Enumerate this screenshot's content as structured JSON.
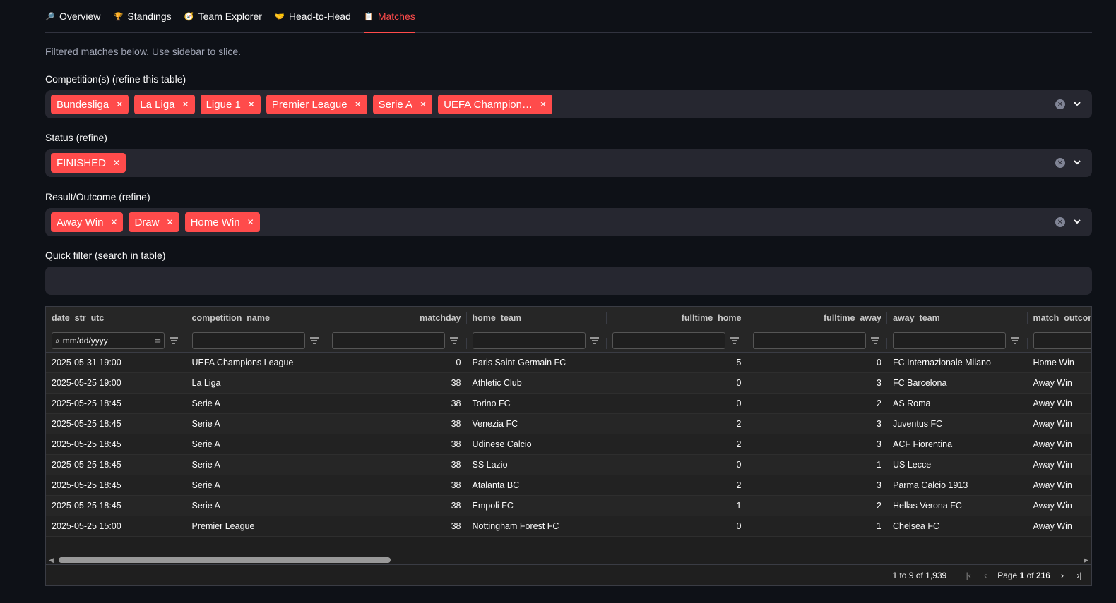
{
  "tabs": [
    {
      "icon": "magnifier-icon",
      "glyph": "🔎",
      "label": "Overview"
    },
    {
      "icon": "trophy-icon",
      "glyph": "🏆",
      "label": "Standings"
    },
    {
      "icon": "compass-icon",
      "glyph": "🧭",
      "label": "Team Explorer"
    },
    {
      "icon": "handshake-icon",
      "glyph": "🤝",
      "label": "Head-to-Head"
    },
    {
      "icon": "clipboard-icon",
      "glyph": "📋",
      "label": "Matches"
    }
  ],
  "active_tab": "Matches",
  "caption": "Filtered matches below. Use sidebar to slice.",
  "filters": {
    "competition": {
      "label": "Competition(s) (refine this table)",
      "chips": [
        "Bundesliga",
        "La Liga",
        "Ligue 1",
        "Premier League",
        "Serie A",
        "UEFA Champion…"
      ]
    },
    "status": {
      "label": "Status (refine)",
      "chips": [
        "FINISHED"
      ]
    },
    "outcome": {
      "label": "Result/Outcome (refine)",
      "chips": [
        "Away Win",
        "Draw",
        "Home Win"
      ]
    },
    "quick": {
      "label": "Quick filter (search in table)",
      "value": ""
    }
  },
  "colors": {
    "accent": "#ff4b4b",
    "background": "#0e1117",
    "input_bg": "#262730"
  },
  "grid": {
    "columns": [
      "date_str_utc",
      "competition_name",
      "matchday",
      "home_team",
      "fulltime_home",
      "fulltime_away",
      "away_team",
      "match_outcom"
    ],
    "date_placeholder": "mm/dd/yyyy",
    "rows": [
      [
        "2025-05-31 19:00",
        "UEFA Champions League",
        "0",
        "Paris Saint-Germain FC",
        "5",
        "0",
        "FC Internazionale Milano",
        "Home Win"
      ],
      [
        "2025-05-25 19:00",
        "La Liga",
        "38",
        "Athletic Club",
        "0",
        "3",
        "FC Barcelona",
        "Away Win"
      ],
      [
        "2025-05-25 18:45",
        "Serie A",
        "38",
        "Torino FC",
        "0",
        "2",
        "AS Roma",
        "Away Win"
      ],
      [
        "2025-05-25 18:45",
        "Serie A",
        "38",
        "Venezia FC",
        "2",
        "3",
        "Juventus FC",
        "Away Win"
      ],
      [
        "2025-05-25 18:45",
        "Serie A",
        "38",
        "Udinese Calcio",
        "2",
        "3",
        "ACF Fiorentina",
        "Away Win"
      ],
      [
        "2025-05-25 18:45",
        "Serie A",
        "38",
        "SS Lazio",
        "0",
        "1",
        "US Lecce",
        "Away Win"
      ],
      [
        "2025-05-25 18:45",
        "Serie A",
        "38",
        "Atalanta BC",
        "2",
        "3",
        "Parma Calcio 1913",
        "Away Win"
      ],
      [
        "2025-05-25 18:45",
        "Serie A",
        "38",
        "Empoli FC",
        "1",
        "2",
        "Hellas Verona FC",
        "Away Win"
      ],
      [
        "2025-05-25 15:00",
        "Premier League",
        "38",
        "Nottingham Forest FC",
        "0",
        "1",
        "Chelsea FC",
        "Away Win"
      ]
    ],
    "pager": {
      "range": "1 to 9 of 1,939",
      "page_prefix": "Page",
      "page": "1",
      "of": "of",
      "total_pages": "216"
    }
  }
}
